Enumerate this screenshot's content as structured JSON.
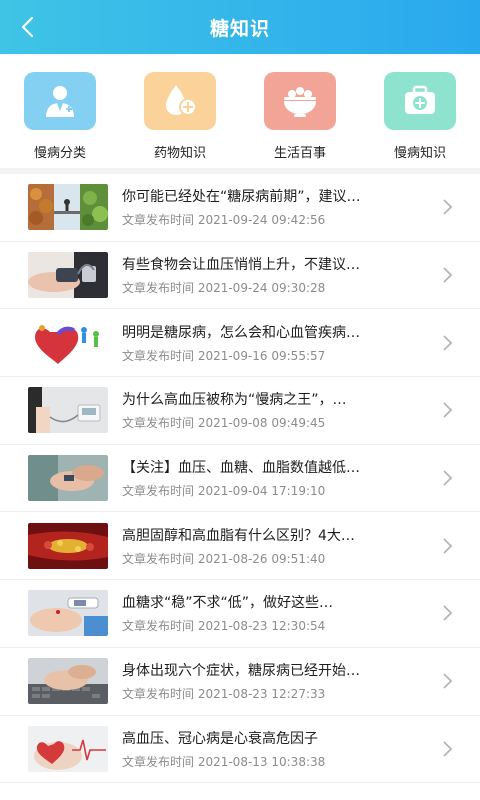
{
  "header": {
    "title": "糖知识",
    "back_icon": "back-chevron-icon"
  },
  "categories": [
    {
      "label": "慢病分类",
      "icon": "doctor-icon",
      "color": "#84d0f2"
    },
    {
      "label": "药物知识",
      "icon": "medicine-drop-icon",
      "color": "#fbd39a"
    },
    {
      "label": "生活百事",
      "icon": "food-bowl-icon",
      "color": "#f2a597"
    },
    {
      "label": "慢病知识",
      "icon": "medical-kit-icon",
      "color": "#8ee3cf"
    }
  ],
  "articles": [
    {
      "title": "你可能已经处在“糖尿病前期”，建议…",
      "time": "文章发布时间 2021-09-24 09:42:56"
    },
    {
      "title": "有些食物会让血压悄悄上升，不建议…",
      "time": "文章发布时间 2021-09-24 09:30:28"
    },
    {
      "title": "明明是糖尿病，怎么会和心血管疾病…",
      "time": "文章发布时间 2021-09-16 09:55:57"
    },
    {
      "title": "为什么高血压被称为“慢病之王”，…",
      "time": "文章发布时间 2021-09-08 09:49:45"
    },
    {
      "title": "【关注】血压、血糖、血脂数值越低…",
      "time": "文章发布时间 2021-09-04 17:19:10"
    },
    {
      "title": "高胆固醇和高血脂有什么区别？4大…",
      "time": "文章发布时间 2021-08-26 09:51:40"
    },
    {
      "title": "血糖求“稳”不求“低”，做好这些…",
      "time": "文章发布时间 2021-08-23 12:30:54"
    },
    {
      "title": "身体出现六个症状，糖尿病已经开始…",
      "time": "文章发布时间 2021-08-23 12:27:33"
    },
    {
      "title": "高血压、冠心病是心衰高危因子",
      "time": "文章发布时间 2021-08-13 10:38:38"
    }
  ]
}
